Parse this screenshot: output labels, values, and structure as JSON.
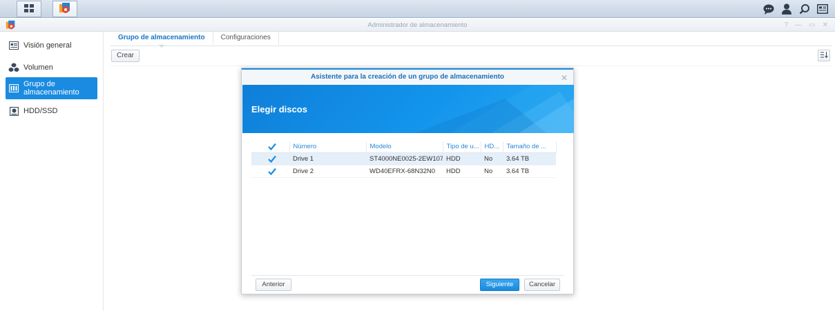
{
  "window": {
    "title": "Administrador de almacenamiento",
    "controls": [
      "?",
      "—",
      "▭",
      "✕"
    ]
  },
  "sidebar": {
    "items": [
      {
        "label": "Visión general",
        "icon": "overview-icon"
      },
      {
        "label": "Volumen",
        "icon": "volume-icon"
      },
      {
        "label": "Grupo de almacenamiento",
        "icon": "storage-pool-icon",
        "active": true
      },
      {
        "label": "HDD/SSD",
        "icon": "disk-icon"
      }
    ]
  },
  "main": {
    "tabs": [
      {
        "label": "Grupo de almacenamiento",
        "active": true
      },
      {
        "label": "Configuraciones"
      }
    ],
    "create_label": "Crear"
  },
  "dialog": {
    "title": "Asistente para la creación de un grupo de almacenamiento",
    "heading": "Elegir discos",
    "columns": [
      "Número",
      "Modelo",
      "Tipo de u...",
      "HD...",
      "Tamaño de ..."
    ],
    "rows": [
      {
        "checked": true,
        "number": "Drive 1",
        "model": "ST4000NE0025-2EW107",
        "type": "HDD",
        "hd": "No",
        "size": "3.64 TB",
        "selected": true
      },
      {
        "checked": true,
        "number": "Drive 2",
        "model": "WD40EFRX-68N32N0",
        "type": "HDD",
        "hd": "No",
        "size": "3.64 TB",
        "selected": false
      }
    ],
    "buttons": {
      "previous": "Anterior",
      "next": "Siguiente",
      "cancel": "Cancelar"
    }
  },
  "colors": {
    "accent": "#1a8be0",
    "banner": "#1394ec"
  }
}
